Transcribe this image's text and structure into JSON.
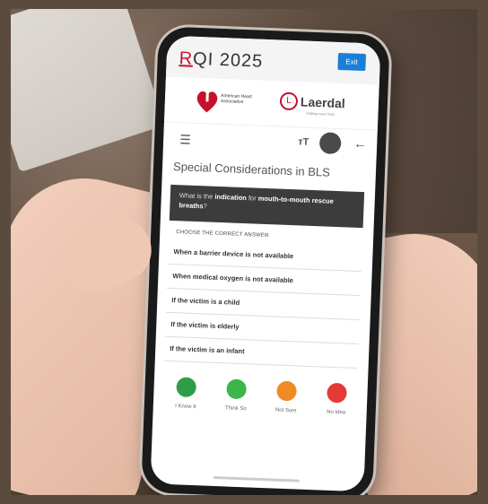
{
  "app": {
    "logo_prefix": "R",
    "logo_rest": "QI 2025",
    "exit_label": "Exit"
  },
  "partners": {
    "aha_name": "American Heart Association",
    "laerdal_name": "Laerdal",
    "laerdal_tagline": "helping save lives"
  },
  "toolbar": {
    "menu_icon": "menu-icon",
    "text_size_label": "тT",
    "back_icon": "arrow-left-icon"
  },
  "page": {
    "title": "Special Considerations in BLS",
    "question_prefix": "What is the ",
    "question_bold1": "indication",
    "question_mid": " for ",
    "question_bold2": "mouth-to-mouth rescue breaths",
    "question_suffix": "?",
    "instruction": "CHOOSE THE CORRECT ANSWER",
    "answers": [
      "When a barrier device is not available",
      "When medical oxygen is not available",
      "If the victim is a child",
      "If the victim is elderly",
      "If the victim is an infant"
    ]
  },
  "confidence": [
    {
      "label": "I Know It",
      "color": "#2e9e46"
    },
    {
      "label": "Think So",
      "color": "#3cb54a"
    },
    {
      "label": "Not Sure",
      "color": "#f08a24"
    },
    {
      "label": "No Idea",
      "color": "#e53935"
    }
  ]
}
